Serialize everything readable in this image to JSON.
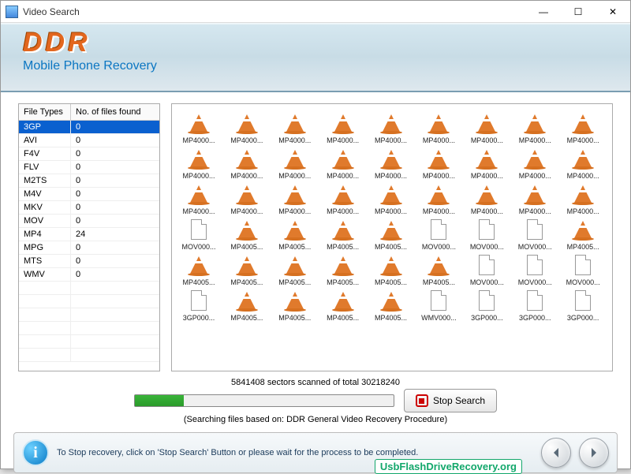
{
  "window": {
    "title": "Video Search"
  },
  "header": {
    "logo": "DDR",
    "subtitle": "Mobile Phone Recovery"
  },
  "fileTypes": {
    "col1": "File Types",
    "col2": "No. of files found",
    "rows": [
      {
        "type": "3GP",
        "count": "0",
        "selected": true
      },
      {
        "type": "AVI",
        "count": "0"
      },
      {
        "type": "F4V",
        "count": "0"
      },
      {
        "type": "FLV",
        "count": "0"
      },
      {
        "type": "M2TS",
        "count": "0"
      },
      {
        "type": "M4V",
        "count": "0"
      },
      {
        "type": "MKV",
        "count": "0"
      },
      {
        "type": "MOV",
        "count": "0"
      },
      {
        "type": "MP4",
        "count": "24"
      },
      {
        "type": "MPG",
        "count": "0"
      },
      {
        "type": "MTS",
        "count": "0"
      },
      {
        "type": "WMV",
        "count": "0"
      }
    ]
  },
  "files": [
    {
      "name": "MP4000...",
      "icon": "cone"
    },
    {
      "name": "MP4000...",
      "icon": "cone"
    },
    {
      "name": "MP4000...",
      "icon": "cone"
    },
    {
      "name": "MP4000...",
      "icon": "cone"
    },
    {
      "name": "MP4000...",
      "icon": "cone"
    },
    {
      "name": "MP4000...",
      "icon": "cone"
    },
    {
      "name": "MP4000...",
      "icon": "cone"
    },
    {
      "name": "MP4000...",
      "icon": "cone"
    },
    {
      "name": "MP4000...",
      "icon": "cone"
    },
    {
      "name": "MP4000...",
      "icon": "cone"
    },
    {
      "name": "MP4000...",
      "icon": "cone"
    },
    {
      "name": "MP4000...",
      "icon": "cone"
    },
    {
      "name": "MP4000...",
      "icon": "cone"
    },
    {
      "name": "MP4000...",
      "icon": "cone"
    },
    {
      "name": "MP4000...",
      "icon": "cone"
    },
    {
      "name": "MP4000...",
      "icon": "cone"
    },
    {
      "name": "MP4000...",
      "icon": "cone"
    },
    {
      "name": "MP4000...",
      "icon": "cone"
    },
    {
      "name": "MP4000...",
      "icon": "cone"
    },
    {
      "name": "MP4000...",
      "icon": "cone"
    },
    {
      "name": "MP4000...",
      "icon": "cone"
    },
    {
      "name": "MP4000...",
      "icon": "cone"
    },
    {
      "name": "MP4000...",
      "icon": "cone"
    },
    {
      "name": "MP4000...",
      "icon": "cone"
    },
    {
      "name": "MP4000...",
      "icon": "cone"
    },
    {
      "name": "MP4000...",
      "icon": "cone"
    },
    {
      "name": "MP4000...",
      "icon": "cone"
    },
    {
      "name": "MOV000...",
      "icon": "file"
    },
    {
      "name": "MP4005...",
      "icon": "cone"
    },
    {
      "name": "MP4005...",
      "icon": "cone"
    },
    {
      "name": "MP4005...",
      "icon": "cone"
    },
    {
      "name": "MP4005...",
      "icon": "cone"
    },
    {
      "name": "MOV000...",
      "icon": "file"
    },
    {
      "name": "MOV000...",
      "icon": "file"
    },
    {
      "name": "MOV000...",
      "icon": "file"
    },
    {
      "name": "MP4005...",
      "icon": "cone"
    },
    {
      "name": "MP4005...",
      "icon": "cone"
    },
    {
      "name": "MP4005...",
      "icon": "cone"
    },
    {
      "name": "MP4005...",
      "icon": "cone"
    },
    {
      "name": "MP4005...",
      "icon": "cone"
    },
    {
      "name": "MP4005...",
      "icon": "cone"
    },
    {
      "name": "MP4005...",
      "icon": "cone"
    },
    {
      "name": "MOV000...",
      "icon": "file"
    },
    {
      "name": "MOV000...",
      "icon": "file"
    },
    {
      "name": "MOV000...",
      "icon": "file"
    },
    {
      "name": "3GP000...",
      "icon": "file"
    },
    {
      "name": "MP4005...",
      "icon": "cone"
    },
    {
      "name": "MP4005...",
      "icon": "cone"
    },
    {
      "name": "MP4005...",
      "icon": "cone"
    },
    {
      "name": "MP4005...",
      "icon": "cone"
    },
    {
      "name": "WMV000...",
      "icon": "file"
    },
    {
      "name": "3GP000...",
      "icon": "file"
    },
    {
      "name": "3GP000...",
      "icon": "file"
    },
    {
      "name": "3GP000...",
      "icon": "file"
    }
  ],
  "progress": {
    "status": "5841408 sectors scanned of total 30218240",
    "hint": "(Searching files based on:  DDR General Video Recovery Procedure)",
    "stopLabel": "Stop Search"
  },
  "footer": {
    "message": "To Stop recovery, click on 'Stop Search' Button or please wait for the process to be completed.",
    "watermark": "UsbFlashDriveRecovery.org"
  }
}
